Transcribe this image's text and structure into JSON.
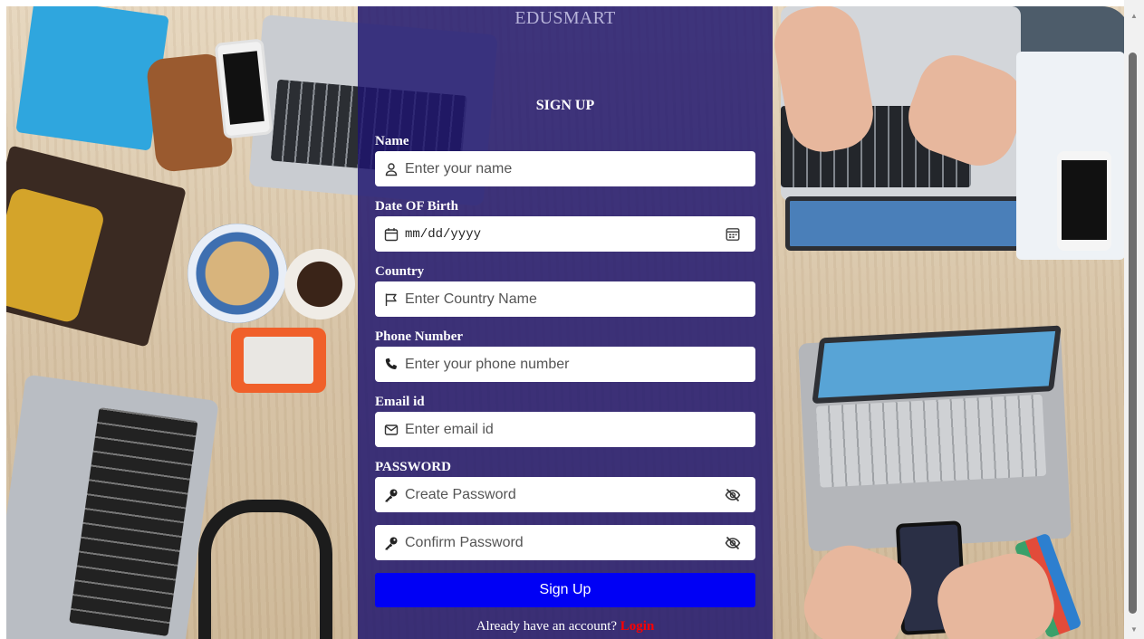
{
  "app": {
    "brand": "EDUSMART"
  },
  "form": {
    "title": "SIGN UP",
    "fields": [
      {
        "label": "Name",
        "placeholder": "Enter your name",
        "icon": "user-icon"
      },
      {
        "label": "Date OF Birth",
        "placeholder": "mm/dd/yyyy",
        "icon": "calendar-icon",
        "trailing_icon": "calendar-picker-icon"
      },
      {
        "label": "Country",
        "placeholder": "Enter Country Name",
        "icon": "flag-icon"
      },
      {
        "label": "Phone Number",
        "placeholder": "Enter your phone number",
        "icon": "phone-icon"
      },
      {
        "label": "Email id",
        "placeholder": "Enter email id",
        "icon": "envelope-icon"
      }
    ],
    "password": {
      "label": "PASSWORD",
      "create_placeholder": "Create Password",
      "confirm_placeholder": "Confirm Password",
      "icon": "key-icon",
      "toggle_icon": "eye-slash-icon"
    },
    "submit_label": "Sign Up",
    "footer_text": "Already have an account?",
    "login_link": "Login"
  },
  "colors": {
    "panel": "#1e146e",
    "button": "#0000f5",
    "link": "#ff0000"
  }
}
